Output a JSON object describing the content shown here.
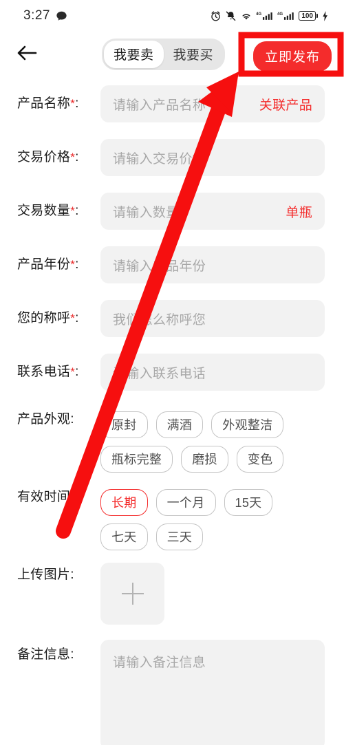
{
  "statusbar": {
    "time": "3:27",
    "icons_left": [
      "chat-bubble-icon"
    ],
    "icons_right": [
      "alarm-icon",
      "bell-muted-icon",
      "wifi-icon",
      "signal-4g-icon",
      "signal-4g-icon",
      "battery-icon",
      "charging-bolt-icon"
    ],
    "network_label": "4G",
    "battery_level": "100"
  },
  "header": {
    "back_icon": "back-arrow-icon",
    "tabs": [
      {
        "label": "我要卖",
        "active": true
      },
      {
        "label": "我要买",
        "active": false
      }
    ],
    "publish_label": "立即发布"
  },
  "form": {
    "fields": [
      {
        "label": "产品名称",
        "required": true,
        "placeholder": "请输入产品名称",
        "value": "",
        "suffix": "关联产品"
      },
      {
        "label": "交易价格",
        "required": true,
        "placeholder": "请输入交易价格",
        "value": "",
        "suffix": ""
      },
      {
        "label": "交易数量",
        "required": true,
        "placeholder": "请输入数量",
        "value": "",
        "suffix": "单瓶"
      },
      {
        "label": "产品年份",
        "required": true,
        "placeholder": "请输入产品年份",
        "value": "",
        "suffix": ""
      },
      {
        "label": "您的称呼",
        "required": true,
        "placeholder": "我们怎么称呼您",
        "value": "",
        "suffix": ""
      },
      {
        "label": "联系电话",
        "required": true,
        "placeholder": "请输入联系电话",
        "value": "",
        "suffix": ""
      }
    ],
    "appearance": {
      "label": "产品外观",
      "required": false,
      "chips": [
        {
          "label": "原封",
          "selected": false
        },
        {
          "label": "满酒",
          "selected": false
        },
        {
          "label": "外观整洁",
          "selected": false
        },
        {
          "label": "瓶标完整",
          "selected": false
        },
        {
          "label": "磨损",
          "selected": false
        },
        {
          "label": "变色",
          "selected": false
        }
      ]
    },
    "validity": {
      "label": "有效时间",
      "required": true,
      "chips": [
        {
          "label": "长期",
          "selected": true
        },
        {
          "label": "一个月",
          "selected": false
        },
        {
          "label": "15天",
          "selected": false
        },
        {
          "label": "七天",
          "selected": false
        },
        {
          "label": "三天",
          "selected": false
        }
      ]
    },
    "upload": {
      "label": "上传图片",
      "required": false,
      "add_icon": "plus-icon"
    },
    "notes": {
      "label": "备注信息",
      "required": false,
      "placeholder": "请输入备注信息",
      "value": ""
    },
    "required_marker": "*",
    "colon": ":"
  },
  "annotation": {
    "color": "#f60f0f",
    "highlight_target": "立即发布",
    "shapes": [
      "highlight-rectangle",
      "pointer-arrow"
    ]
  }
}
